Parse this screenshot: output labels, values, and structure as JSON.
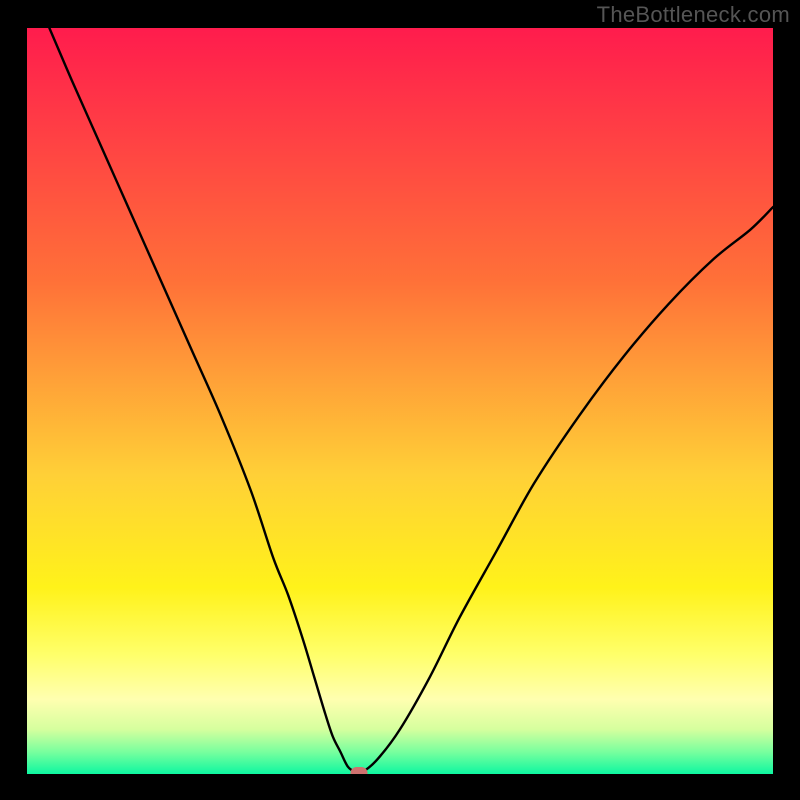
{
  "watermark_text": "TheBottleneck.com",
  "chart_data": {
    "type": "line",
    "title": "",
    "xlabel": "",
    "ylabel": "",
    "xlim": [
      0,
      100
    ],
    "ylim": [
      0,
      100
    ],
    "grid": false,
    "curve": {
      "comment": "V-shaped bottleneck curve. x is percentage across plot width; y is percentage height where 0=bottom, 100=top.",
      "x": [
        3,
        6,
        10,
        14,
        18,
        22,
        26,
        30,
        33,
        35,
        37,
        38.5,
        40,
        41,
        42,
        43,
        44,
        45,
        47,
        50,
        54,
        58,
        63,
        68,
        74,
        80,
        86,
        92,
        97,
        100
      ],
      "y": [
        100,
        93,
        84,
        75,
        66,
        57,
        48,
        38,
        29,
        24,
        18,
        13,
        8,
        5,
        3,
        1,
        0.3,
        0.3,
        2,
        6,
        13,
        21,
        30,
        39,
        48,
        56,
        63,
        69,
        73,
        76
      ]
    },
    "marker": {
      "x": 44.5,
      "y": 0.2
    },
    "background": {
      "type": "vertical-gradient",
      "stops": [
        {
          "pos": 0,
          "color": "#ff1c4d"
        },
        {
          "pos": 34,
          "color": "#ff7138"
        },
        {
          "pos": 60,
          "color": "#ffd037"
        },
        {
          "pos": 75,
          "color": "#fff21a"
        },
        {
          "pos": 84,
          "color": "#ffff6a"
        },
        {
          "pos": 90,
          "color": "#ffffb0"
        },
        {
          "pos": 94,
          "color": "#d6ff9e"
        },
        {
          "pos": 97,
          "color": "#7aff9e"
        },
        {
          "pos": 100,
          "color": "#0ef7a0"
        }
      ]
    }
  }
}
